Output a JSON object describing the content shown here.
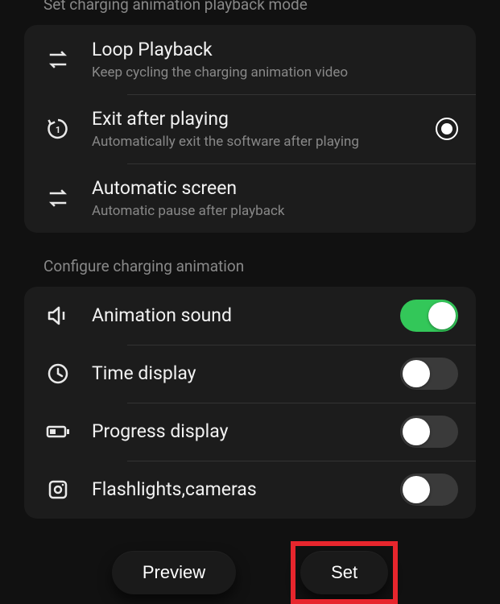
{
  "section1": {
    "header": "Set charging animation playback mode",
    "options": [
      {
        "title": "Loop Playback",
        "sub": "Keep cycling the charging animation video",
        "selected": false
      },
      {
        "title": "Exit after playing",
        "sub": "Automatically exit the software after playing",
        "selected": true
      },
      {
        "title": "Automatic screen",
        "sub": "Automatic pause after playback",
        "selected": false
      }
    ]
  },
  "section2": {
    "header": "Configure charging animation",
    "items": [
      {
        "label": "Animation sound",
        "on": true
      },
      {
        "label": "Time display",
        "on": false
      },
      {
        "label": "Progress display",
        "on": false
      },
      {
        "label": "Flashlights,cameras",
        "on": false
      }
    ]
  },
  "buttons": {
    "preview": "Preview",
    "set": "Set"
  }
}
